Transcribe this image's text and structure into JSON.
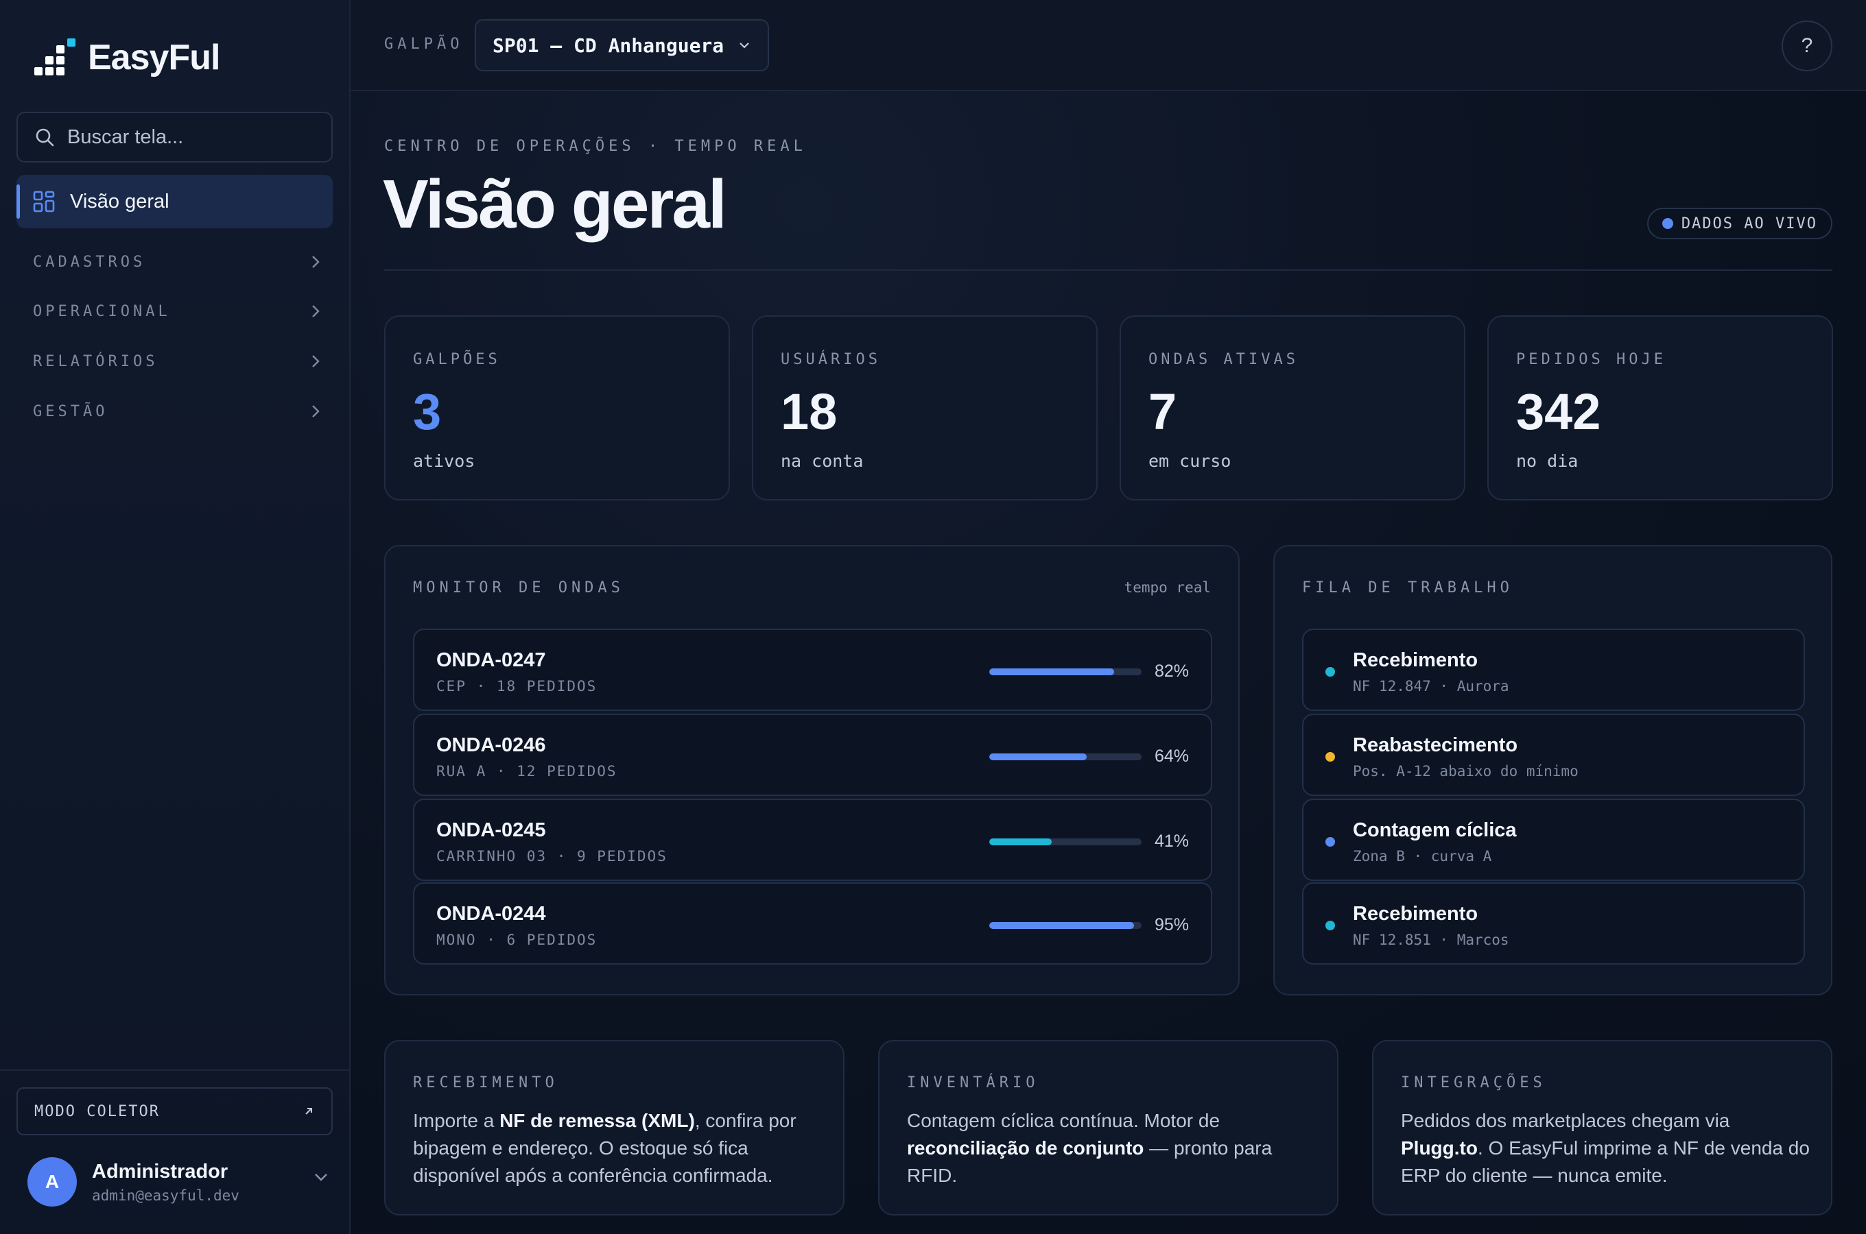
{
  "brand": {
    "name": "EasyFul"
  },
  "sidebar": {
    "search_placeholder": "Buscar tela...",
    "active_item": "Visão geral",
    "groups": [
      "CADASTROS",
      "OPERACIONAL",
      "RELATÓRIOS",
      "GESTÃO"
    ],
    "collector_label": "MODO COLETOR",
    "user": {
      "initial": "A",
      "name": "Administrador",
      "email": "admin@easyful.dev"
    }
  },
  "topbar": {
    "warehouse_label": "GALPÃO",
    "warehouse_value": "SP01 — CD Anhanguera",
    "help_label": "?"
  },
  "header": {
    "eyebrow": "CENTRO DE OPERAÇÕES · TEMPO REAL",
    "title": "Visão geral",
    "live_badge": "DADOS AO VIVO"
  },
  "stats": [
    {
      "label": "GALPÕES",
      "value": "3",
      "sub": "ativos"
    },
    {
      "label": "USUÁRIOS",
      "value": "18",
      "sub": "na conta"
    },
    {
      "label": "ONDAS ATIVAS",
      "value": "7",
      "sub": "em curso"
    },
    {
      "label": "PEDIDOS HOJE",
      "value": "342",
      "sub": "no dia"
    }
  ],
  "waves": {
    "title": "MONITOR DE ONDAS",
    "right_label": "tempo real",
    "items": [
      {
        "name": "ONDA-0247",
        "sub": "CEP · 18 PEDIDOS",
        "progress": 82,
        "pct": "82%",
        "color": "#5b8cf5"
      },
      {
        "name": "ONDA-0246",
        "sub": "RUA A · 12 PEDIDOS",
        "progress": 64,
        "pct": "64%",
        "color": "#5b8cf5"
      },
      {
        "name": "ONDA-0245",
        "sub": "CARRINHO 03 · 9 PEDIDOS",
        "progress": 41,
        "pct": "41%",
        "color": "#1fb8d6"
      },
      {
        "name": "ONDA-0244",
        "sub": "MONO · 6 PEDIDOS",
        "progress": 95,
        "pct": "95%",
        "color": "#5b8cf5"
      }
    ]
  },
  "queue": {
    "title": "FILA DE TRABALHO",
    "items": [
      {
        "name": "Recebimento",
        "sub": "NF 12.847 · Aurora",
        "color": "#1fb8d6"
      },
      {
        "name": "Reabastecimento",
        "sub": "Pos. A-12 abaixo do mínimo",
        "color": "#f2b630"
      },
      {
        "name": "Contagem cíclica",
        "sub": "Zona B · curva A",
        "color": "#5b8cf5"
      },
      {
        "name": "Recebimento",
        "sub": "NF 12.851 · Marcos",
        "color": "#1fb8d6"
      }
    ]
  },
  "info": [
    {
      "label": "RECEBIMENTO",
      "t1": "Importe a ",
      "b1": "NF de remessa (XML)",
      "t2": ", confira por bipagem e endereço. O estoque só fica disponível após a conferência confirmada."
    },
    {
      "label": "INVENTÁRIO",
      "t1": "Contagem cíclica contínua. Motor de ",
      "b1": "reconciliação de conjunto",
      "t2": " — pronto para RFID."
    },
    {
      "label": "INTEGRAÇÕES",
      "t1": "Pedidos dos marketplaces chegam via ",
      "b1": "Plugg.to",
      "t2": ". O EasyFul imprime a NF de venda do ERP do cliente — nunca emite."
    }
  ]
}
